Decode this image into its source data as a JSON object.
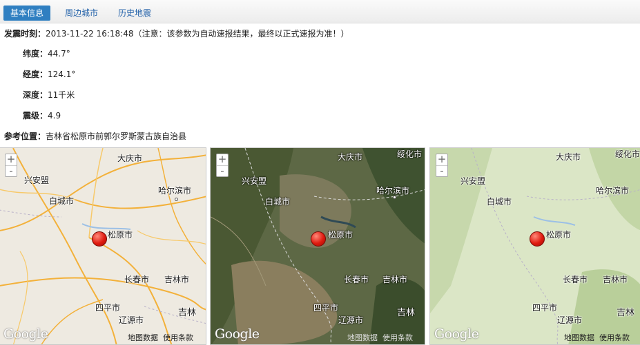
{
  "tabs": [
    {
      "label": "基本信息",
      "active": true
    },
    {
      "label": "周边城市",
      "active": false
    },
    {
      "label": "历史地震",
      "active": false
    }
  ],
  "info": {
    "time_label": "发震时刻：",
    "time_value": "2013-11-22 16:18:48（注意：该参数为自动速报结果，最终以正式速报为准！）",
    "lat_label": "纬度：",
    "lat_value": "44.7°",
    "lon_label": "经度：",
    "lon_value": "124.1°",
    "depth_label": "深度：",
    "depth_value": "11千米",
    "mag_label": "震级：",
    "mag_value": "4.9",
    "loc_label": "参考位置：",
    "loc_value": "吉林省松原市前郭尔罗斯蒙古族自治县"
  },
  "maps": [
    {
      "type": "roadmap",
      "cities": {
        "daqing": "大庆市",
        "xinganmeng": "兴安盟",
        "haerbin": "哈尔滨市",
        "baicheng": "白城市",
        "songyuan": "松原市",
        "changchun": "长春市",
        "jilin_city": "吉林市",
        "siping": "四平市",
        "liaoyuan": "辽源市",
        "jilin": "吉林"
      },
      "zoom_in": "+",
      "zoom_out": "-",
      "google": "Google",
      "map_data": "地图数据",
      "terms": "使用条款"
    },
    {
      "type": "satellite",
      "cities": {
        "suihua": "绥化市",
        "daqing": "大庆市",
        "xinganmeng": "兴安盟",
        "haerbin": "哈尔滨市",
        "baicheng": "白城市",
        "songyuan": "松原市",
        "changchun": "长春市",
        "jilin_city": "吉林市",
        "siping": "四平市",
        "liaoyuan": "辽源市",
        "jilin": "吉林"
      },
      "zoom_in": "+",
      "zoom_out": "-",
      "google": "Google",
      "map_data": "地图数据",
      "terms": "使用条款"
    },
    {
      "type": "terrain",
      "cities": {
        "suihua": "绥化市",
        "daqing": "大庆市",
        "xinganmeng": "兴安盟",
        "haerbin": "哈尔滨市",
        "baicheng": "白城市",
        "songyuan": "松原市",
        "changchun": "长春市",
        "jilin_city": "吉林市",
        "siping": "四平市",
        "liaoyuan": "辽源市",
        "jilin": "吉林"
      },
      "zoom_in": "+",
      "zoom_out": "-",
      "google": "Google",
      "map_data": "地图数据",
      "terms": "使用条款"
    }
  ],
  "colors": {
    "tab_active_bg": "#2f7fc1",
    "tab_text": "#1f5fa8",
    "marker": "#e01b10",
    "road": "#f3b13a"
  }
}
